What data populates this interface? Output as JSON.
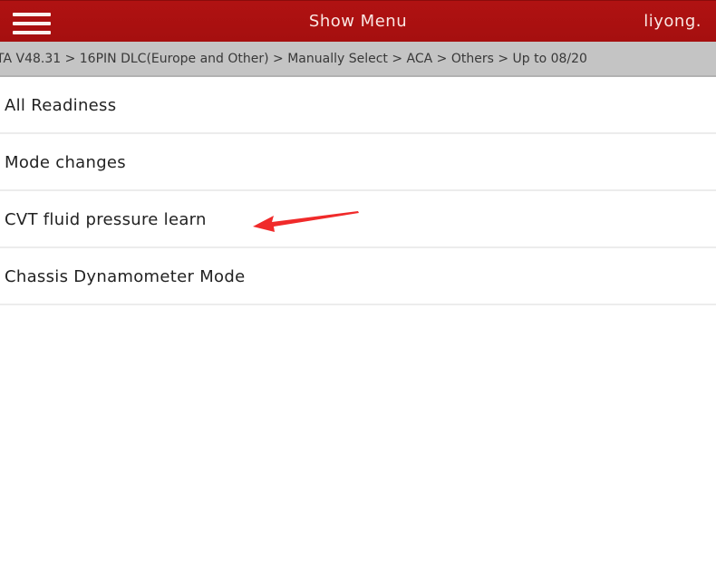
{
  "header": {
    "menu_icon": "hamburger-menu-icon",
    "title": "Show Menu",
    "user": "liyong."
  },
  "breadcrumb": {
    "text": "TA V48.31 > 16PIN DLC(Europe and Other) > Manually Select > ACA > Others > Up to 08/20"
  },
  "menu": {
    "items": [
      {
        "label": "All Readiness"
      },
      {
        "label": "Mode changes"
      },
      {
        "label": "CVT fluid pressure learn"
      },
      {
        "label": "Chassis Dynamometer Mode"
      }
    ]
  },
  "annotation": {
    "type": "arrow",
    "points_to": "CVT fluid pressure learn",
    "color": "#f02a2a"
  },
  "colors": {
    "header_bg": "#a81010",
    "breadcrumb_bg": "#c4c4c4",
    "divider": "#ececec"
  }
}
